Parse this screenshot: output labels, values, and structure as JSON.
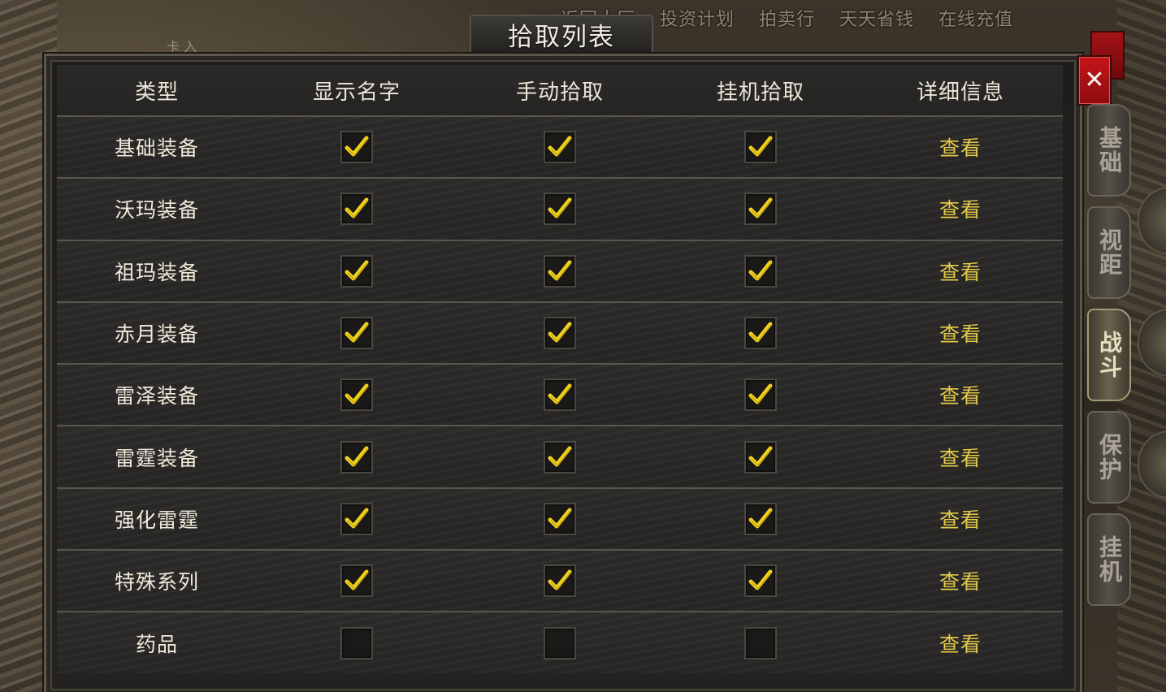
{
  "top_menu": {
    "items": [
      "返回大厅",
      "投资计划",
      "拍卖行",
      "天天省钱",
      "在线充值"
    ],
    "fragment": "卡 入"
  },
  "dialog": {
    "title": "拾取列表",
    "close_label": "✕"
  },
  "table": {
    "headers": [
      "类型",
      "显示名字",
      "手动拾取",
      "挂机拾取",
      "详细信息"
    ],
    "rows": [
      {
        "type": "基础装备",
        "show_name": true,
        "manual_pickup": true,
        "auto_pickup": true,
        "detail": "查看"
      },
      {
        "type": "沃玛装备",
        "show_name": true,
        "manual_pickup": true,
        "auto_pickup": true,
        "detail": "查看"
      },
      {
        "type": "祖玛装备",
        "show_name": true,
        "manual_pickup": true,
        "auto_pickup": true,
        "detail": "查看"
      },
      {
        "type": "赤月装备",
        "show_name": true,
        "manual_pickup": true,
        "auto_pickup": true,
        "detail": "查看"
      },
      {
        "type": "雷泽装备",
        "show_name": true,
        "manual_pickup": true,
        "auto_pickup": true,
        "detail": "查看"
      },
      {
        "type": "雷霆装备",
        "show_name": true,
        "manual_pickup": true,
        "auto_pickup": true,
        "detail": "查看"
      },
      {
        "type": "强化雷霆",
        "show_name": true,
        "manual_pickup": true,
        "auto_pickup": true,
        "detail": "查看"
      },
      {
        "type": "特殊系列",
        "show_name": true,
        "manual_pickup": true,
        "auto_pickup": true,
        "detail": "查看"
      },
      {
        "type": "药品",
        "show_name": false,
        "manual_pickup": false,
        "auto_pickup": false,
        "detail": "查看"
      }
    ]
  },
  "side_tabs": [
    {
      "label": "基础",
      "active": false
    },
    {
      "label": "视距",
      "active": false
    },
    {
      "label": "战斗",
      "active": true
    },
    {
      "label": "保护",
      "active": false
    },
    {
      "label": "挂机",
      "active": false
    }
  ],
  "colors": {
    "checkmark": "#f2d21c",
    "view_link": "#e3c94a",
    "close_button": "#c7151a"
  }
}
